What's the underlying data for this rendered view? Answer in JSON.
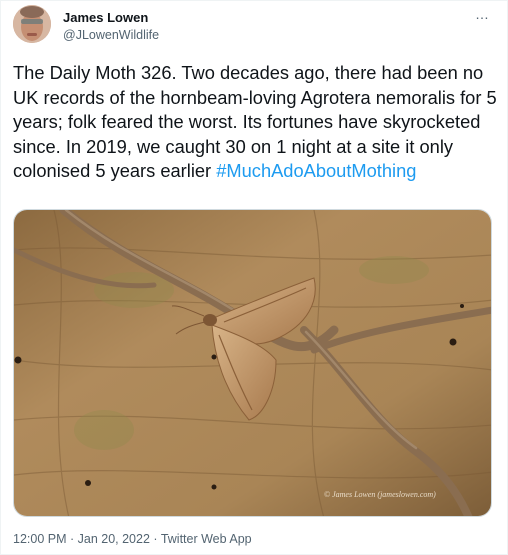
{
  "author": {
    "name": "James Lowen",
    "handle": "@JLowenWildlife"
  },
  "tweet": {
    "text": "The Daily Moth 326. Two decades ago, there had been no UK records of the hornbeam-loving Agrotera nemoralis for 5 years; folk feared the worst. Its fortunes have skyrocketed since. In 2019, we caught 30 on 1 night at a site it only colonised 5 years earlier ",
    "hashtag": "#MuchAdoAboutMothing",
    "more_icon": "…"
  },
  "photo": {
    "watermark": "© James Lowen (jameslowen.com)"
  },
  "meta": {
    "time": "12:00 PM",
    "separator": " · ",
    "date": "Jan 20, 2022",
    "source": "Twitter Web App"
  }
}
